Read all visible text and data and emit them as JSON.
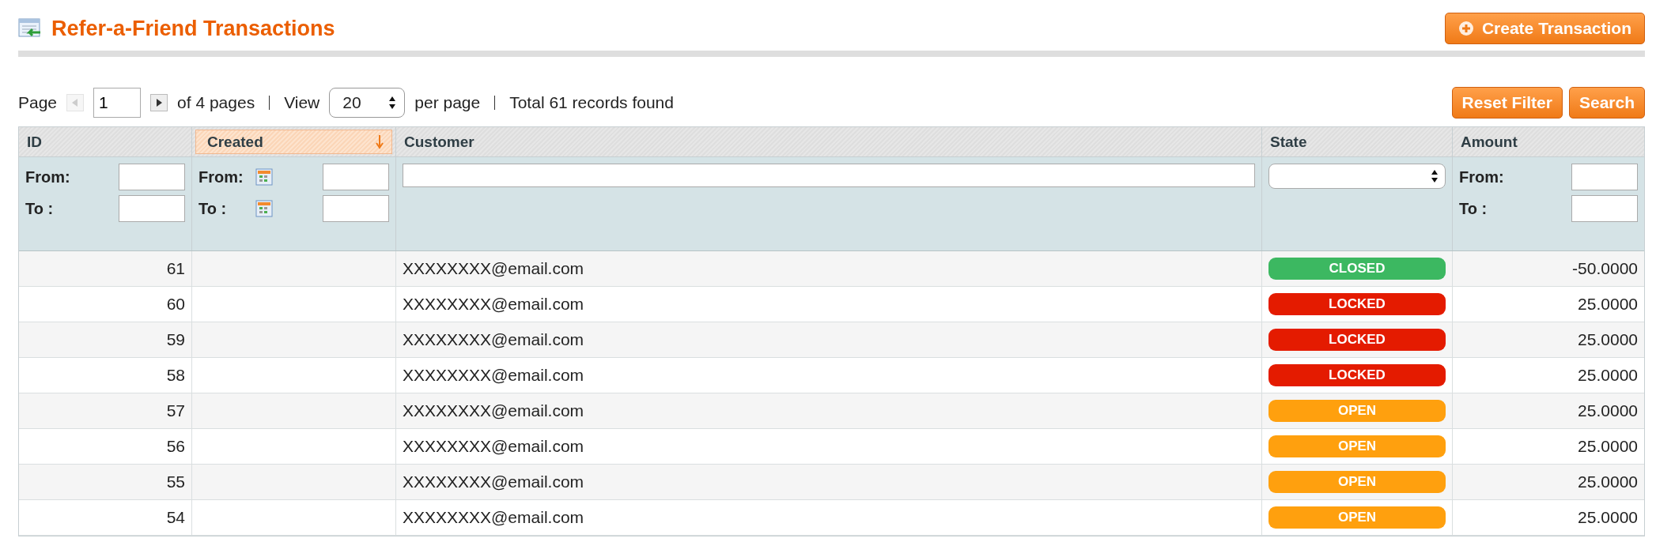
{
  "page_title": "Refer-a-Friend Transactions",
  "create_button": "Create Transaction",
  "pager": {
    "page_label": "Page",
    "page_value": "1",
    "of_pages": "of 4 pages",
    "view_label": "View",
    "per_page_value": "20",
    "per_page_label": "per page",
    "total": "Total 61 records found"
  },
  "filter_buttons": [
    "Reset Filter",
    "Search"
  ],
  "columns": [
    {
      "label": "ID",
      "sorted": false,
      "kind": "range",
      "from_label": "From:",
      "to_label": "To :"
    },
    {
      "label": "Created",
      "sorted": true,
      "kind": "date_range",
      "from_label": "From:",
      "to_label": "To :"
    },
    {
      "label": "Customer",
      "sorted": false,
      "kind": "text"
    },
    {
      "label": "State",
      "sorted": false,
      "kind": "select"
    },
    {
      "label": "Amount",
      "sorted": false,
      "kind": "range",
      "from_label": "From:",
      "to_label": "To :"
    }
  ],
  "rows": [
    {
      "id": "61",
      "customer": "XXXXXXXX@email.com",
      "state": "CLOSED",
      "kind": "closed",
      "amount": "-50.0000"
    },
    {
      "id": "60",
      "customer": "XXXXXXXX@email.com",
      "state": "LOCKED",
      "kind": "locked",
      "amount": "25.0000"
    },
    {
      "id": "59",
      "customer": "XXXXXXXX@email.com",
      "state": "LOCKED",
      "kind": "locked",
      "amount": "25.0000"
    },
    {
      "id": "58",
      "customer": "XXXXXXXX@email.com",
      "state": "LOCKED",
      "kind": "locked",
      "amount": "25.0000"
    },
    {
      "id": "57",
      "customer": "XXXXXXXX@email.com",
      "state": "OPEN",
      "kind": "open",
      "amount": "25.0000"
    },
    {
      "id": "56",
      "customer": "XXXXXXXX@email.com",
      "state": "OPEN",
      "kind": "open",
      "amount": "25.0000"
    },
    {
      "id": "55",
      "customer": "XXXXXXXX@email.com",
      "state": "OPEN",
      "kind": "open",
      "amount": "25.0000"
    },
    {
      "id": "54",
      "customer": "XXXXXXXX@email.com",
      "state": "OPEN",
      "kind": "open",
      "amount": "25.0000"
    }
  ]
}
